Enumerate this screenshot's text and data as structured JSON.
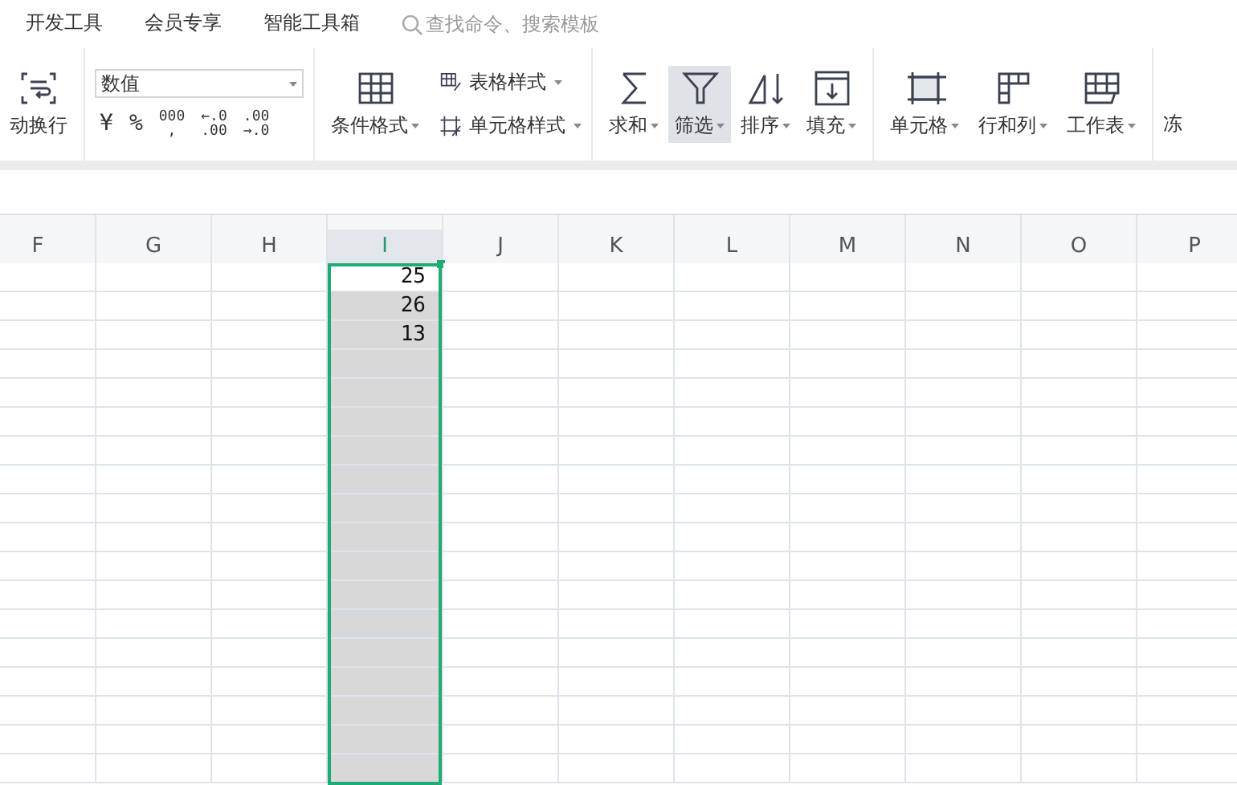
{
  "menu_tabs": [
    {
      "label": "开发工具",
      "selected": false
    },
    {
      "label": "会员专享",
      "selected": false
    },
    {
      "label": "智能工具箱",
      "selected": false
    }
  ],
  "search": {
    "placeholder": "查找命令、搜索模板"
  },
  "ribbon": {
    "wrap_label": "动换行",
    "number_format": {
      "value": "数值"
    },
    "number_buttons": [
      {
        "kind": "text",
        "lines": [
          "¥"
        ]
      },
      {
        "kind": "text",
        "lines": [
          "%"
        ]
      },
      {
        "kind": "stack",
        "lines": [
          "000",
          ","
        ]
      },
      {
        "kind": "stack",
        "lines": [
          "←.0",
          ".00"
        ]
      },
      {
        "kind": "stack",
        "lines": [
          ".00",
          "→.0"
        ]
      }
    ],
    "style_group": {
      "conditional": "条件格式",
      "table_style": "表格样式",
      "cell_style": "单元格样式"
    },
    "tools": [
      {
        "label": "求和",
        "selected": false
      },
      {
        "label": "筛选",
        "selected": true
      },
      {
        "label": "排序",
        "selected": false
      },
      {
        "label": "填充",
        "selected": false
      }
    ],
    "cell_tools": [
      {
        "label": "单元格"
      },
      {
        "label": "行和列"
      },
      {
        "label": "工作表"
      }
    ],
    "cut_label": "冻"
  },
  "sheet": {
    "columns": [
      {
        "label": "F",
        "selected": false
      },
      {
        "label": "G",
        "selected": false
      },
      {
        "label": "H",
        "selected": false
      },
      {
        "label": "I",
        "selected": true
      },
      {
        "label": "J",
        "selected": false
      },
      {
        "label": "K",
        "selected": false
      },
      {
        "label": "L",
        "selected": false
      },
      {
        "label": "M",
        "selected": false
      },
      {
        "label": "N",
        "selected": false
      },
      {
        "label": "O",
        "selected": false
      },
      {
        "label": "P",
        "selected": false
      }
    ],
    "selected_column_values": [
      "25",
      "26",
      "13"
    ]
  }
}
